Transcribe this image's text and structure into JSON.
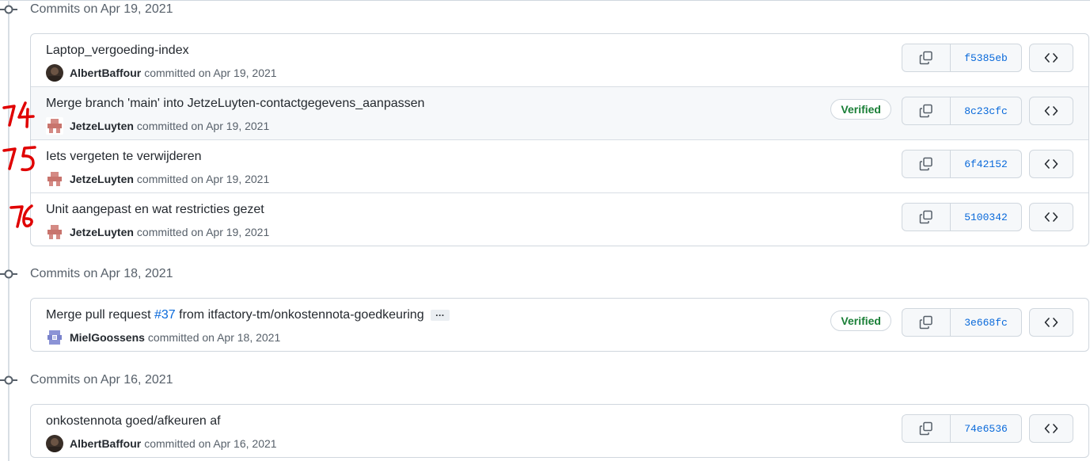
{
  "groups": [
    {
      "title": "Commits on Apr 19, 2021",
      "commits": [
        {
          "message": "Laptop_vergoeding-index",
          "author": "AlbertBaffour",
          "when": "committed on Apr 19, 2021",
          "sha": "f5385eb",
          "verified": ""
        },
        {
          "message": "Merge branch 'main' into JetzeLuyten-contactgegevens_aanpassen",
          "author": "JetzeLuyten",
          "when": "committed on Apr 19, 2021",
          "sha": "8c23cfc",
          "verified": "Verified"
        },
        {
          "message": "Iets vergeten te verwijderen",
          "author": "JetzeLuyten",
          "when": "committed on Apr 19, 2021",
          "sha": "6f42152",
          "verified": ""
        },
        {
          "message": "Unit aangepast en wat restricties gezet",
          "author": "JetzeLuyten",
          "when": "committed on Apr 19, 2021",
          "sha": "5100342",
          "verified": ""
        }
      ]
    },
    {
      "title": "Commits on Apr 18, 2021",
      "commits": [
        {
          "message_prefix": "Merge pull request ",
          "message_link": "#37",
          "message_suffix": " from itfactory-tm/onkostennota-goedkeuring",
          "ellipsis": "…",
          "author": "MielGoossens",
          "when": "committed on Apr 18, 2021",
          "sha": "3e668fc",
          "verified": "Verified"
        }
      ]
    },
    {
      "title": "Commits on Apr 16, 2021",
      "commits": [
        {
          "message": "onkostennota goed/afkeuren af",
          "author": "AlbertBaffour",
          "when": "committed on Apr 16, 2021",
          "sha": "74e6536",
          "verified": ""
        }
      ]
    }
  ],
  "annotations": [
    "74",
    "75",
    "76"
  ],
  "icons": {
    "node": "git-commit-icon",
    "copy": "copy-icon",
    "browse": "code-icon"
  },
  "colors": {
    "link": "#0969da",
    "verified": "#1a7f37",
    "annotation": "#e00000"
  }
}
